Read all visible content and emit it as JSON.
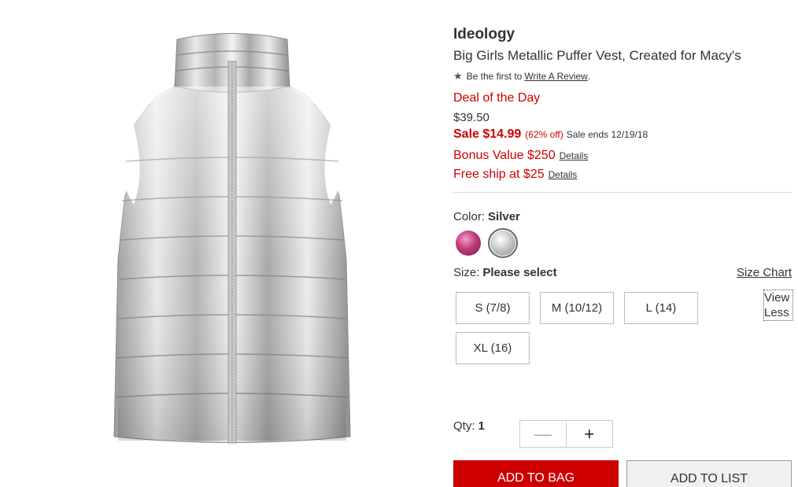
{
  "product": {
    "brand": "Ideology",
    "title": "Big Girls Metallic Puffer Vest, Created for Macy's",
    "image_icon": "metallic-silver-puffer-vest"
  },
  "review": {
    "prefix": "Be the first to",
    "link": "Write A Review",
    "suffix": "."
  },
  "pricing": {
    "deal_label": "Deal of the Day",
    "original_price": "$39.50",
    "sale_price": "Sale $14.99",
    "percent_off": "(62% off)",
    "sale_ends": "Sale ends 12/19/18"
  },
  "promos": [
    {
      "text": "Bonus Value $250",
      "link": "Details"
    },
    {
      "text": "Free ship at $25",
      "link": "Details"
    }
  ],
  "color": {
    "label": "Color:",
    "selected": "Silver",
    "swatches": [
      {
        "name": "Pink Metallic",
        "color": "#c0397a"
      },
      {
        "name": "Silver",
        "color": "#cfcfcf"
      }
    ]
  },
  "size": {
    "label": "Size:",
    "value": "Please select",
    "chart_link": "Size Chart",
    "options": [
      "S (7/8)",
      "M (10/12)",
      "L (14)",
      "XL (16)"
    ],
    "view_less_line1": "View",
    "view_less_line2": "Less"
  },
  "quantity": {
    "label": "Qty:",
    "value": "1",
    "minus": "—",
    "plus": "+"
  },
  "actions": {
    "add_to_bag": "ADD TO BAG",
    "add_to_list": "ADD TO LIST"
  },
  "colors": {
    "accent": "#cc0000",
    "text": "#333333"
  }
}
